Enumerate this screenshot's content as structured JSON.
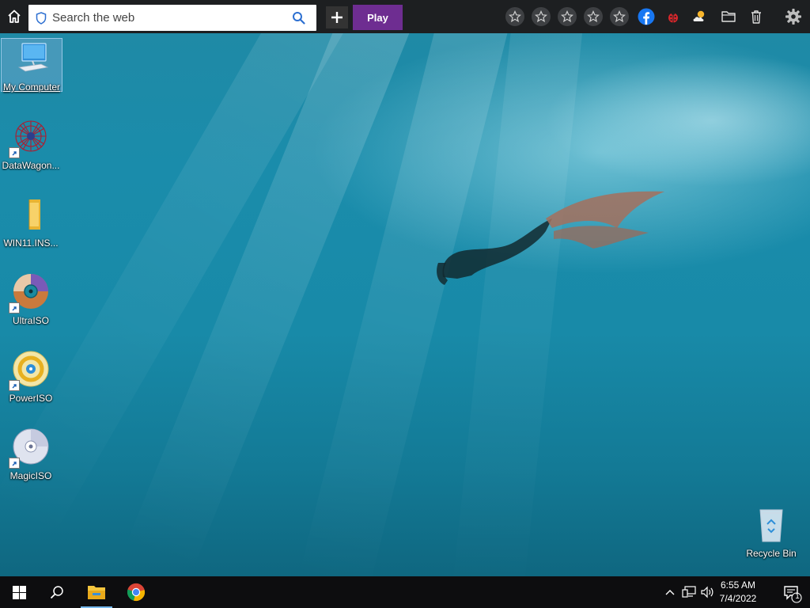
{
  "toolbar": {
    "search_placeholder": "Search the web",
    "play_label": "Play",
    "icons": [
      "home-icon",
      "shield-icon",
      "search-icon",
      "plus-icon",
      "star-icon",
      "star-icon",
      "star-icon",
      "star-icon",
      "star-icon",
      "facebook-icon",
      "ladybug-icon",
      "weather-icon",
      "folder-icon",
      "trash-icon",
      "gear-icon"
    ],
    "colors": {
      "bar": "#1d1f21",
      "play": "#6e2d91",
      "facebook": "#1877f2"
    }
  },
  "desktop": {
    "icons": [
      {
        "label": "My Computer",
        "icon": "computer-icon",
        "selected": true
      },
      {
        "label": "DataWagon...",
        "icon": "datawagon-icon",
        "shortcut": true
      },
      {
        "label": "WIN11.INS...",
        "icon": "folder-icon"
      },
      {
        "label": "UltraISO",
        "icon": "disc-icon",
        "shortcut": true
      },
      {
        "label": "PowerISO",
        "icon": "disc-icon",
        "shortcut": true
      },
      {
        "label": "MagicISO",
        "icon": "disc-icon",
        "shortcut": true
      },
      {
        "label": "Recycle Bin",
        "icon": "recycle-bin-icon"
      }
    ]
  },
  "taskbar": {
    "icons": [
      "windows-start-icon",
      "search-icon",
      "file-explorer-icon",
      "chrome-icon",
      "chevron-up-icon",
      "network-icon",
      "volume-icon",
      "notification-icon"
    ],
    "time": "6:55 AM",
    "date": "7/4/2022",
    "notification_count": "1"
  }
}
